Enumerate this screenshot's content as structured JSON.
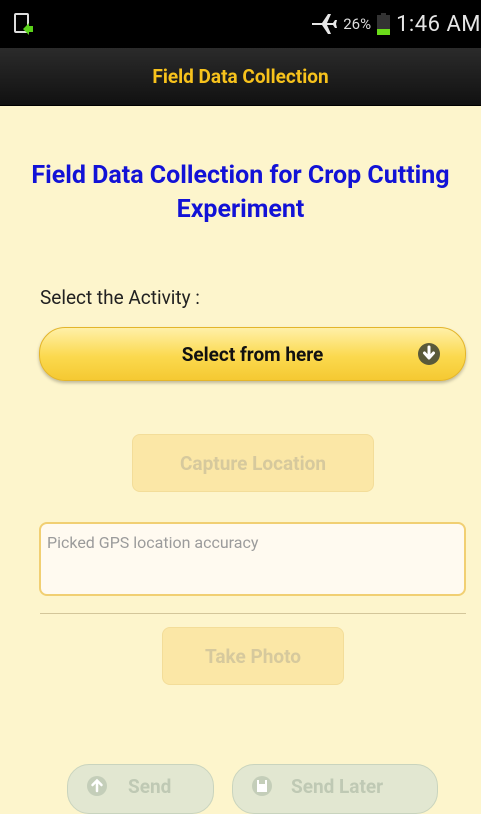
{
  "status_bar": {
    "battery_percent": "26%",
    "time": "1:46 AM",
    "icons": [
      "screenshot-icon",
      "airplane-mode-icon",
      "battery-icon"
    ]
  },
  "action_bar": {
    "title": "Field Data Collection"
  },
  "main": {
    "heading": "Field Data Collection for Crop Cutting Experiment",
    "activity_label": "Select the Activity :",
    "select_placeholder": "Select from here",
    "capture_button": "Capture Location",
    "gps_placeholder": "Picked GPS location accuracy",
    "take_photo_button": "Take Photo",
    "send_button": "Send",
    "send_later_button": "Send Later"
  },
  "colors": {
    "background": "#fdf5cc",
    "heading": "#1212d6",
    "action_title": "#f7c21c",
    "select_button": "#fbd94e"
  }
}
